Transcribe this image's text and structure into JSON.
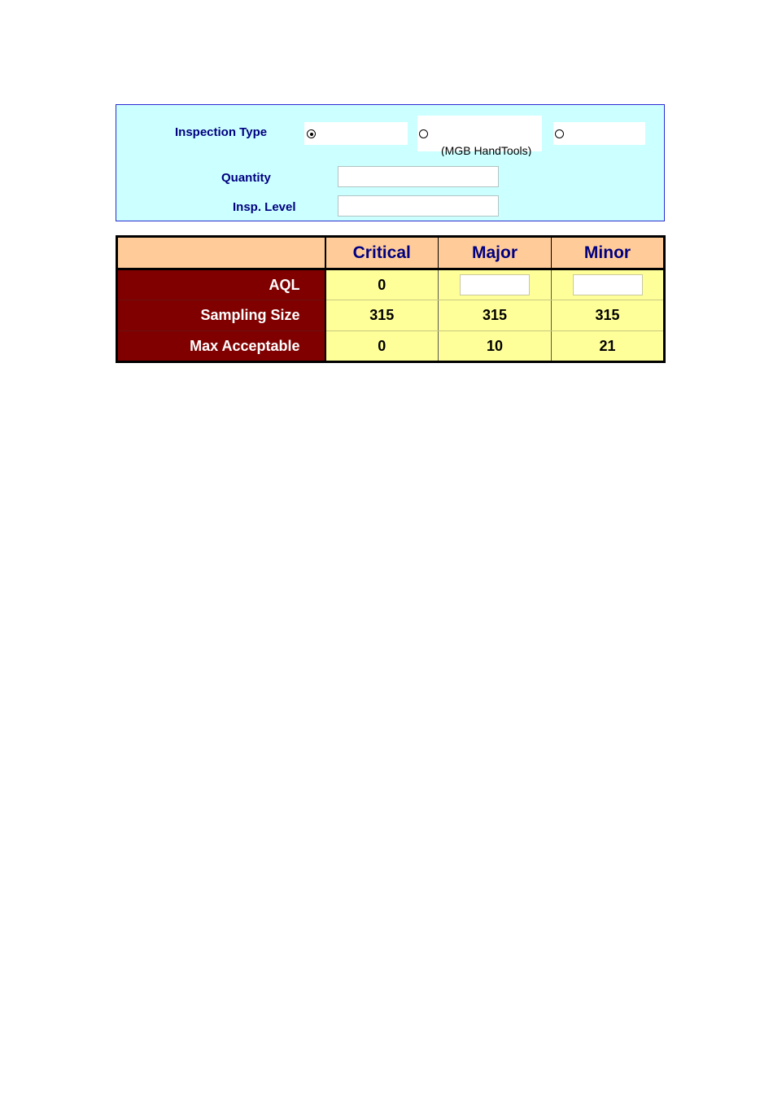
{
  "inspection_panel": {
    "inspection_type_label": "Inspection Type",
    "options": [
      {
        "label": "",
        "checked": true
      },
      {
        "label": "",
        "note": "(MGB HandTools)",
        "checked": false
      },
      {
        "label": "",
        "checked": false
      }
    ],
    "quantity_label": "Quantity",
    "quantity_value": "",
    "insp_level_label": "Insp. Level",
    "insp_level_value": ""
  },
  "aql_table": {
    "columns": [
      "Critical",
      "Major",
      "Minor"
    ],
    "rows": [
      {
        "label": "AQL",
        "values": [
          "0",
          "",
          ""
        ]
      },
      {
        "label": "Sampling Size",
        "values": [
          "315",
          "315",
          "315"
        ]
      },
      {
        "label": "Max Acceptable",
        "values": [
          "0",
          "10",
          "21"
        ]
      }
    ]
  },
  "colors": {
    "panel_bg": "#ccffff",
    "panel_border": "#2a2ad0",
    "label_text": "#000080",
    "header_bg": "#ffcc99",
    "rowhead_bg": "#800000",
    "cell_bg": "#ffff99"
  }
}
